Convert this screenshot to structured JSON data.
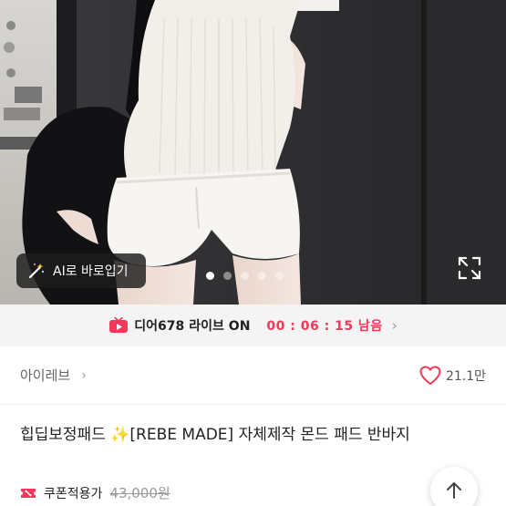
{
  "hero": {
    "ai_button_label": "AI로 바로입기",
    "carousel_dots": 5,
    "active_dot": 0,
    "wand_icon": "magic-wand-icon",
    "expand_icon": "fullscreen-expand-icon"
  },
  "live": {
    "icon": "live-tv-icon",
    "store_name": "디어678",
    "status": "라이브 ON",
    "timer": "00 : 06 : 15 남음",
    "chevron": "›",
    "accent": "#f2395a"
  },
  "shop": {
    "name": "아이레브",
    "chevron": "›",
    "like_count": "21.1만",
    "heart_color": "#f2395a"
  },
  "product": {
    "title": "힙딥보정패드 ✨[REBE MADE] 자체제작 몬드 패드 반바지",
    "coupon_label": "쿠폰적용가",
    "original_price": "43,000원"
  }
}
